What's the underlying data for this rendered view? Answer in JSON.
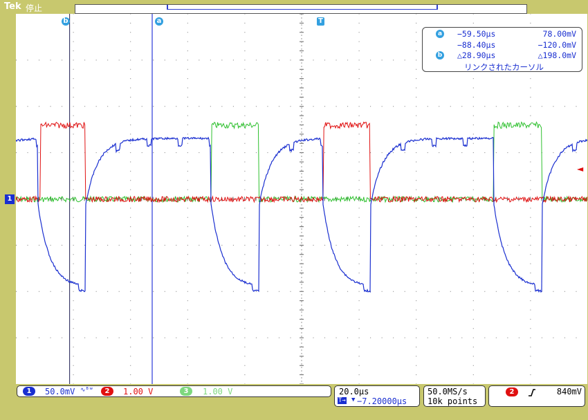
{
  "header": {
    "brand": "Tek",
    "run_state": "停止"
  },
  "markers": {
    "cursor_a": "a",
    "cursor_b": "b",
    "trigger_position": "T",
    "ch1_ground": "1"
  },
  "cursor_readout": {
    "a_time": "−59.50µs",
    "a_value": "78.00mV",
    "b_time": "−88.40µs",
    "b_value": "−120.0mV",
    "delta_time": "△28.90µs",
    "delta_value": "△198.0mV",
    "mode_note": "リンクされたカーソル"
  },
  "channels": [
    {
      "id": "1",
      "scale": "50.0mV",
      "suffix": "∿ᴮʷ",
      "color": "#1a2fd0"
    },
    {
      "id": "2",
      "scale": "1.00 V",
      "color": "#e01010"
    },
    {
      "id": "3",
      "scale": "1.00 V",
      "color": "#2ec02e"
    }
  ],
  "timebase": {
    "per_div": "20.0µs",
    "position": "−7.20000µs",
    "sample_rate": "50.0MS/s",
    "record_length": "10k points"
  },
  "trigger": {
    "source": "2",
    "slope_icon": "rising-edge-icon",
    "level": "840mV"
  },
  "chart_data": {
    "type": "line",
    "x_unit": "µs",
    "xlim": [
      -107.2,
      92.8
    ],
    "grid": true,
    "series": [
      {
        "name": "1",
        "color": "#1a2fd0",
        "scale": "50.0mV/div"
      },
      {
        "name": "2",
        "color": "#e01010",
        "scale": "1.00 V/div"
      },
      {
        "name": "3",
        "color": "#2ec02e",
        "scale": "1.00 V/div"
      }
    ],
    "cursors": {
      "a_time": -59.5,
      "b_time": -88.4
    }
  }
}
